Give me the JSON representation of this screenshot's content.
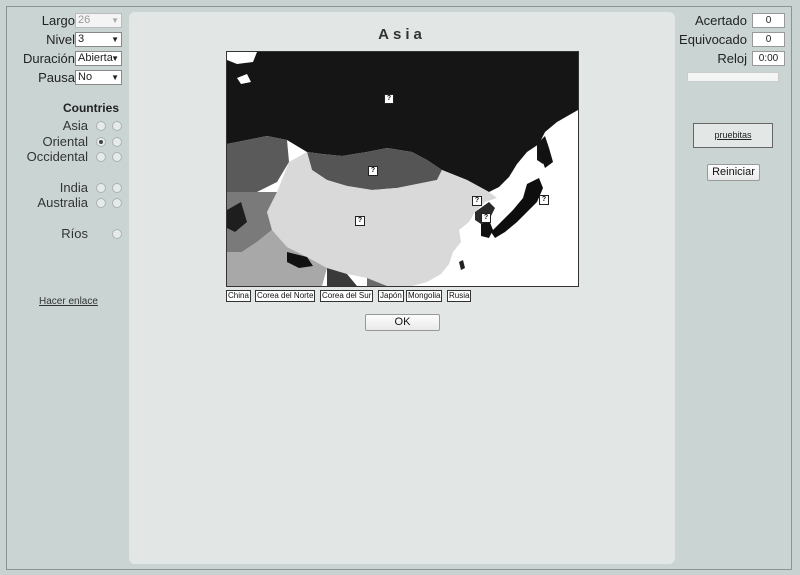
{
  "controls": [
    {
      "label": "Largo",
      "value": "26",
      "disabled": true
    },
    {
      "label": "Nivel",
      "value": "3",
      "disabled": false
    },
    {
      "label": "Duración",
      "value": "Abierta",
      "disabled": false
    },
    {
      "label": "Pausa",
      "value": "No",
      "disabled": false
    }
  ],
  "countries_section": {
    "title": "Countries",
    "rows": [
      {
        "label": "Asia",
        "selected": null
      },
      {
        "label": "Oriental",
        "selected": 1
      },
      {
        "label": "Occidental",
        "selected": null
      },
      {
        "label": "India",
        "selected": null
      },
      {
        "label": "Australia",
        "selected": null
      }
    ],
    "rivers_label": "Ríos"
  },
  "link_label": "Hacer enlace",
  "center": {
    "title": "Asia",
    "map_marker_label": "?",
    "country_names": [
      "China",
      "Corea del Norte",
      "Corea del Sur",
      "Japón",
      "Mongolia",
      "Rusia"
    ],
    "ok_label": "OK"
  },
  "stats": {
    "correct_label": "Acertado",
    "correct_value": "0",
    "wrong_label": "Equivocado",
    "wrong_value": "0",
    "clock_label": "Reloj",
    "clock_value": "0:00",
    "progress": 0
  },
  "pruebitas_label": "pruebitas",
  "reset_label": "Reiniciar"
}
